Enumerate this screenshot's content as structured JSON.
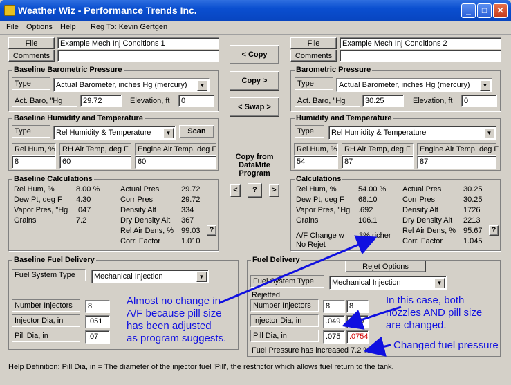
{
  "title": "Weather Wiz - Performance Trends Inc.",
  "menu": {
    "file": "File",
    "options": "Options",
    "help": "Help",
    "reg": "Reg To: Kevin Gertgen"
  },
  "left": {
    "file_btn": "File",
    "comments_btn": "Comments",
    "file_name": "Example Mech Inj Conditions 1",
    "comments": "",
    "baro_title": "Baseline Barometric Pressure",
    "type_lbl": "Type",
    "baro_type": "Actual Barometer, inches Hg (mercury)",
    "act_baro_lbl": "Act. Baro, \"Hg",
    "act_baro": "29.72",
    "elev_lbl": "Elevation, ft",
    "elev": "0",
    "hum_title": "Baseline Humidity and Temperature",
    "hum_type": "Rel Humidity & Temperature",
    "scan": "Scan",
    "relhum_lbl": "Rel Hum, %",
    "relhum": "8",
    "rhair_lbl": "RH Air Temp, deg F",
    "rhair": "60",
    "engair_lbl": "Engine Air Temp, deg F",
    "engair": "60",
    "calc_title": "Baseline Calculations",
    "calc_left": [
      [
        "Rel Hum, %",
        "8.00 %"
      ],
      [
        "Dew Pt, deg F",
        "4.30"
      ],
      [
        "Vapor Pres, \"Hg",
        ".047"
      ],
      [
        "Grains",
        "7.2"
      ]
    ],
    "calc_right": [
      [
        "Actual Pres",
        "29.72"
      ],
      [
        "Corr Pres",
        "29.72"
      ],
      [
        "Density Alt",
        "334"
      ],
      [
        "Dry Density Alt",
        "367"
      ],
      [
        "Rel Air Dens, %",
        "99.03"
      ],
      [
        "Corr. Factor",
        "1.010"
      ]
    ],
    "fuel_title": "Baseline Fuel Delivery",
    "fuel_sys_lbl": "Fuel System Type",
    "fuel_sys": "Mechanical Injection",
    "num_inj_lbl": "Number Injectors",
    "num_inj": "8",
    "inj_dia_lbl": "Injector Dia, in",
    "inj_dia": ".051",
    "pill_lbl": "Pill Dia, in",
    "pill": ".07"
  },
  "middle": {
    "copy_left": "< Copy",
    "copy_right": "Copy >",
    "swap": "< Swap >",
    "copy_from_1": "Copy from",
    "copy_from_2": "DataMite",
    "copy_from_3": "Program",
    "lt": "<",
    "q": "?",
    "gt": ">"
  },
  "right": {
    "file_btn": "File",
    "comments_btn": "Comments",
    "file_name": "Example Mech Inj Conditions 2",
    "comments": "",
    "baro_title": "Barometric Pressure",
    "type_lbl": "Type",
    "baro_type": "Actual Barometer, inches Hg (mercury)",
    "act_baro_lbl": "Act. Baro, \"Hg",
    "act_baro": "30.25",
    "elev_lbl": "Elevation, ft",
    "elev": "0",
    "hum_title": "Humidity and Temperature",
    "hum_type": "Rel Humidity & Temperature",
    "relhum_lbl": "Rel Hum, %",
    "relhum": "54",
    "rhair_lbl": "RH Air Temp, deg F",
    "rhair": "87",
    "engair_lbl": "Engine Air Temp, deg F",
    "engair": "87",
    "calc_title": "Calculations",
    "calc_left": [
      [
        "Rel Hum, %",
        "54.00 %"
      ],
      [
        "Dew Pt, deg F",
        "68.10"
      ],
      [
        "Vapor Pres, \"Hg",
        ".692"
      ],
      [
        "Grains",
        "106.1"
      ]
    ],
    "calc_right": [
      [
        "Actual Pres",
        "30.25"
      ],
      [
        "Corr Pres",
        "30.25"
      ],
      [
        "Density Alt",
        "1726"
      ],
      [
        "Dry Density Alt",
        "2213"
      ],
      [
        "Rel Air Dens, %",
        "95.67"
      ],
      [
        "Corr. Factor",
        "1.045"
      ]
    ],
    "af_lbl": "A/F Change w",
    "af_val": ".3% richer",
    "no_rejet": "No Rejet",
    "fuel_title": "Fuel Delivery",
    "rejet_btn": "Rejet Options",
    "fuel_sys_lbl": "Fuel System Type",
    "fuel_sys": "Mechanical Injection",
    "rejetted": "Rejetted",
    "num_inj_lbl": "Number Injectors",
    "num_inj": "8",
    "num_inj_r": "8",
    "inj_dia_lbl": "Injector Dia, in",
    "inj_dia": ".049",
    "inj_dia_r": ".049",
    "pill_lbl": "Pill Dia, in",
    "pill": ".075",
    "pill_r": ".0754",
    "fuel_press": "Fuel Pressure has increased 7.2 %"
  },
  "annotations": {
    "a1": [
      "Almost no change in",
      "A/F because pill size",
      "has been adjusted",
      "as program suggests."
    ],
    "a2": [
      "In this case, both",
      "nozzles AND pill size",
      "are changed."
    ],
    "a3": "Changed fuel pressure"
  },
  "help_text": "Help Definition:  Pill Dia, in = The diameter of the injector fuel 'Pill', the restrictor which allows fuel return to the tank.",
  "colors": {
    "title_bar": "#0a4fd0",
    "annotation": "#1010e0",
    "red_value": "#d00000"
  }
}
